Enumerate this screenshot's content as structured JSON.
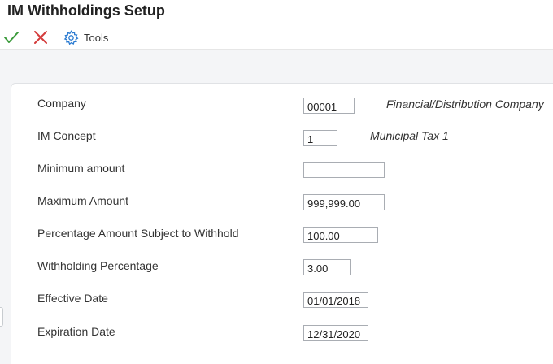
{
  "window": {
    "title": "IM Withholdings Setup"
  },
  "toolbar": {
    "ok_icon": "checkmark-icon",
    "cancel_icon": "x-icon",
    "tools_icon": "gear-icon",
    "tools_label": "Tools",
    "colors": {
      "ok": "#3a9a3a",
      "cancel": "#d43c3c",
      "tools": "#2b7bd1"
    }
  },
  "form": {
    "company": {
      "label": "Company",
      "value": "00001",
      "description": "Financial/Distribution Company"
    },
    "im_concept": {
      "label": "IM Concept",
      "value": "1",
      "description": "Municipal Tax 1"
    },
    "minimum_amount": {
      "label": "Minimum amount",
      "value": ""
    },
    "maximum_amount": {
      "label": "Maximum Amount",
      "value": "999,999.00"
    },
    "percentage_subject": {
      "label": "Percentage Amount Subject to Withhold",
      "value": "100.00"
    },
    "withholding_percentage": {
      "label": "Withholding Percentage",
      "value": "3.00"
    },
    "effective_date": {
      "label": "Effective Date",
      "value": "01/01/2018"
    },
    "expiration_date": {
      "label": "Expiration Date",
      "value": "12/31/2020"
    }
  }
}
